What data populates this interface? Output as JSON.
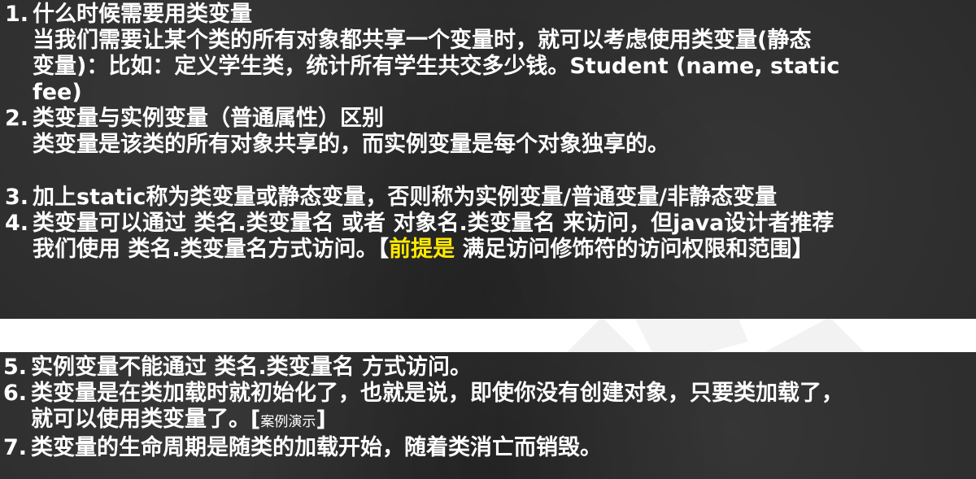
{
  "slide_top": {
    "item1": {
      "num": "1.",
      "heading": "什么时候需要用类变量",
      "line1": "当我们需要让某个类的所有对象都共享一个变量时，就可以考虑使用类变量(静态",
      "line2": "变量)：比如：定义学生类，统计所有学生共交多少钱。Student (name, static",
      "line3": "fee)"
    },
    "item2": {
      "num": "2.",
      "heading": "类变量与实例变量（普通属性）区别",
      "line1": "类变量是该类的所有对象共享的，而实例变量是每个对象独享的。"
    },
    "item3": {
      "num": "3.",
      "line1": "加上static称为类变量或静态变量，否则称为实例变量/普通变量/非静态变量"
    },
    "item4": {
      "num": "4.",
      "line1": "类变量可以通过 类名.类变量名 或者  对象名.类变量名 来访问，但java设计者推荐",
      "line2_before": "我们使用 类名.类变量名方式访问。【",
      "line2_highlight": "前提是",
      "line2_after": " 满足访问修饰符的访问权限和范围】"
    }
  },
  "slide_bottom": {
    "item5": {
      "num": "5.",
      "line1": "实例变量不能通过 类名.类变量名 方式访问。"
    },
    "item6": {
      "num": "6.",
      "line1": "类变量是在类加载时就初始化了，也就是说，即使你没有创建对象，只要类加载了，",
      "line2_before": "就可以使用类变量了。",
      "line2_bracket_open": "[",
      "line2_tag": "案例演示",
      "line2_bracket_close": "]"
    },
    "item7": {
      "num": "7.",
      "line1": "类变量的生命周期是随类的加载开始，随着类消亡而销毁。"
    }
  },
  "colors": {
    "slide_bg": "#2b2b2b",
    "text": "#ffffff",
    "highlight": "#ffea00"
  }
}
